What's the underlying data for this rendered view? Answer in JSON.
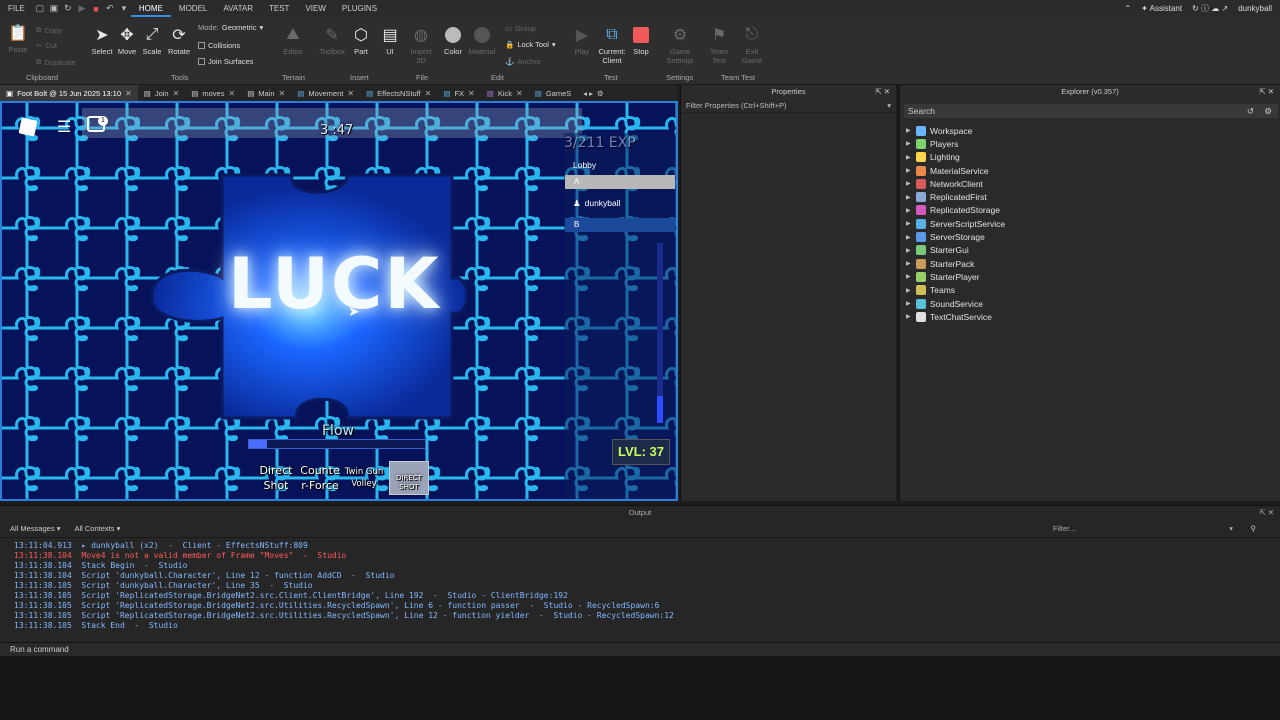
{
  "menubar": {
    "file": "FILE",
    "tabs": [
      "HOME",
      "MODEL",
      "AVATAR",
      "TEST",
      "VIEW",
      "PLUGINS"
    ],
    "assistant": "Assistant",
    "user": "dunkyball"
  },
  "ribbon": {
    "clipboard": {
      "paste": "Paste",
      "copy": "Copy",
      "cut": "Cut",
      "duplicate": "Duplicate",
      "group": "Clipboard"
    },
    "tools": {
      "select": "Select",
      "move": "Move",
      "scale": "Scale",
      "rotate": "Rotate",
      "group": "Tools",
      "mode_label": "Mode:",
      "mode_value": "Geometric",
      "collisions": "Collisions",
      "join_surfaces": "Join Surfaces"
    },
    "terrain": {
      "editor": "Editor",
      "group": "Terrain"
    },
    "insert": {
      "toolbox": "Toolbox",
      "part": "Part",
      "ui": "UI",
      "group": "Insert"
    },
    "file": {
      "import3d": "Import 3D",
      "group": "File"
    },
    "edit": {
      "color": "Color",
      "material": "Material",
      "group_btn": "Group",
      "lock": "Lock Tool",
      "anchor": "Anchor",
      "group": "Edit"
    },
    "test": {
      "play": "Play",
      "current_client": "Current: Client",
      "stop": "Stop",
      "group": "Test"
    },
    "settings": {
      "game_settings": "Game Settings",
      "group": "Settings"
    },
    "team_test": {
      "team_test": "Team Test",
      "exit_game": "Exit Game",
      "group": "Team Test"
    }
  },
  "doc_tabs": [
    {
      "label": "Foot Bolt @ 15 Jun 2025 13:10",
      "active": true
    },
    {
      "label": "Join"
    },
    {
      "label": "moves"
    },
    {
      "label": "Main"
    },
    {
      "label": "Movement"
    },
    {
      "label": "EffectsNStuff"
    },
    {
      "label": "FX"
    },
    {
      "label": "Kick"
    },
    {
      "label": "GameS"
    }
  ],
  "game": {
    "center_word": "LUCK",
    "top_counter": "3 :47",
    "exp_text": "3/211 EXP",
    "lobby": "Lobby",
    "team_a": "A",
    "player": "dunkyball",
    "team_b": "B",
    "flow": "Flow",
    "level": "LVL: 37",
    "chat_badge": "1",
    "flow_fill": 0.1,
    "side_bar_fill": 0.15,
    "skills": [
      {
        "key": "1",
        "label": "Direct Shot"
      },
      {
        "key": "2",
        "label": "Counte r-Force"
      },
      {
        "key": "3",
        "label": "Twin Gun Volley"
      },
      {
        "key": "4",
        "label": "DIRECT SHOT"
      }
    ]
  },
  "properties": {
    "title": "Properties",
    "filter": "Filter Properties (Ctrl+Shift+P)"
  },
  "explorer": {
    "title": "Explorer (v0.357)",
    "search": "Search",
    "items": [
      {
        "label": "Workspace",
        "color": "#6bb7ff"
      },
      {
        "label": "Players",
        "color": "#7bd36b"
      },
      {
        "label": "Lighting",
        "color": "#ffd54a"
      },
      {
        "label": "MaterialService",
        "color": "#e98a4a"
      },
      {
        "label": "NetworkClient",
        "color": "#d85a5a"
      },
      {
        "label": "ReplicatedFirst",
        "color": "#8aa8d8"
      },
      {
        "label": "ReplicatedStorage",
        "color": "#d45ac0"
      },
      {
        "label": "ServerScriptService",
        "color": "#5ab0e8"
      },
      {
        "label": "ServerStorage",
        "color": "#5a9ae8"
      },
      {
        "label": "StarterGui",
        "color": "#7ac97a"
      },
      {
        "label": "StarterPack",
        "color": "#c99a5a"
      },
      {
        "label": "StarterPlayer",
        "color": "#9ad06a"
      },
      {
        "label": "Teams",
        "color": "#d0c05a"
      },
      {
        "label": "SoundService",
        "color": "#5ac0d8"
      },
      {
        "label": "TextChatService",
        "color": "#e0e0e0"
      }
    ]
  },
  "output": {
    "title": "Output",
    "messages_filter": "All Messages",
    "contexts_filter": "All Contexts",
    "filter_placeholder": "Filter...",
    "lines": [
      {
        "text": "13:11:04.913  ▸ dunkyball (x2)  -  Client - EffectsNStuff:809",
        "cls": "blue"
      },
      {
        "text": "13:11:38.104  Move4 is not a valid member of Frame \"Moves\"  -  Studio",
        "cls": "red"
      },
      {
        "text": "13:11:38.104  Stack Begin  -  Studio",
        "cls": "blue"
      },
      {
        "text": "13:11:38.104  Script 'dunkyball.Character', Line 12 - function AddCD  -  Studio",
        "cls": "blue"
      },
      {
        "text": "13:11:38.105  Script 'dunkyball.Character', Line 35  -  Studio",
        "cls": "blue"
      },
      {
        "text": "13:11:38.105  Script 'ReplicatedStorage.BridgeNet2.src.Client.ClientBridge', Line 192  -  Studio - ClientBridge:192",
        "cls": "blue"
      },
      {
        "text": "13:11:38.105  Script 'ReplicatedStorage.BridgeNet2.src.Utilities.RecycledSpawn', Line 6 - function passer  -  Studio - RecycledSpawn:6",
        "cls": "blue"
      },
      {
        "text": "13:11:38.105  Script 'ReplicatedStorage.BridgeNet2.src.Utilities.RecycledSpawn', Line 12 - function yielder  -  Studio - RecycledSpawn:12",
        "cls": "blue"
      },
      {
        "text": "13:11:38.105  Stack End  -  Studio",
        "cls": "blue"
      }
    ],
    "command": "Run a command"
  }
}
